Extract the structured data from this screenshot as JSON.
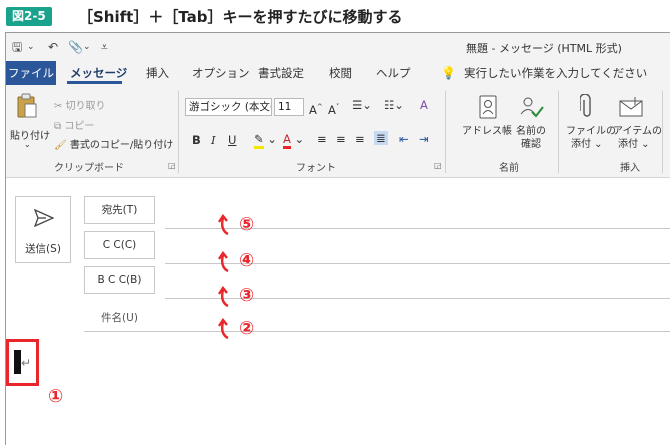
{
  "caption": {
    "badge": "図2-5",
    "title": "［Shift］＋［Tab］キーを押すたびに移動する"
  },
  "window": {
    "title": "無題  -  メッセージ (HTML 形式)"
  },
  "qat": {
    "save": "🖫",
    "undo": "↶",
    "attach": "📎",
    "dropdown": "⌄",
    "more": "⩡"
  },
  "menu": {
    "file": "ファイル",
    "tabs": [
      "メッセージ",
      "挿入",
      "オプション",
      "書式設定",
      "校閲",
      "ヘルプ"
    ],
    "tellme": "実行したい作業を入力してください"
  },
  "ribbon": {
    "clipboard": {
      "paste": "貼り付け",
      "cut": "切り取り",
      "copy": "コピー",
      "format_painter": "書式のコピー/貼り付け",
      "label": "クリップボード"
    },
    "font": {
      "font_name": "游ゴシック (本文(",
      "font_size": "11",
      "grow": "A^",
      "shrink": "A˅",
      "bold": "B",
      "italic": "I",
      "underline": "U",
      "highlight": "ab",
      "font_color": "A",
      "label": "フォント"
    },
    "names": {
      "address_book": "アドレス帳",
      "check_names_1": "名前の",
      "check_names_2": "確認",
      "label": "名前"
    },
    "include": {
      "attach_file_1": "ファイルの",
      "attach_file_2": "添付",
      "attach_item_1": "アイテムの",
      "attach_item_2": "添付",
      "label": "挿入"
    }
  },
  "compose": {
    "send": "送信(S)",
    "to": "宛先(T)",
    "cc": "C C(C)",
    "bcc": "B C C(B)",
    "subject": "件名(U)"
  },
  "annotations": [
    "①",
    "②",
    "③",
    "④",
    "⑤"
  ],
  "colors": {
    "accent": "#2b579a",
    "annotation": "#e8262b",
    "badge": "#1aa38c"
  }
}
